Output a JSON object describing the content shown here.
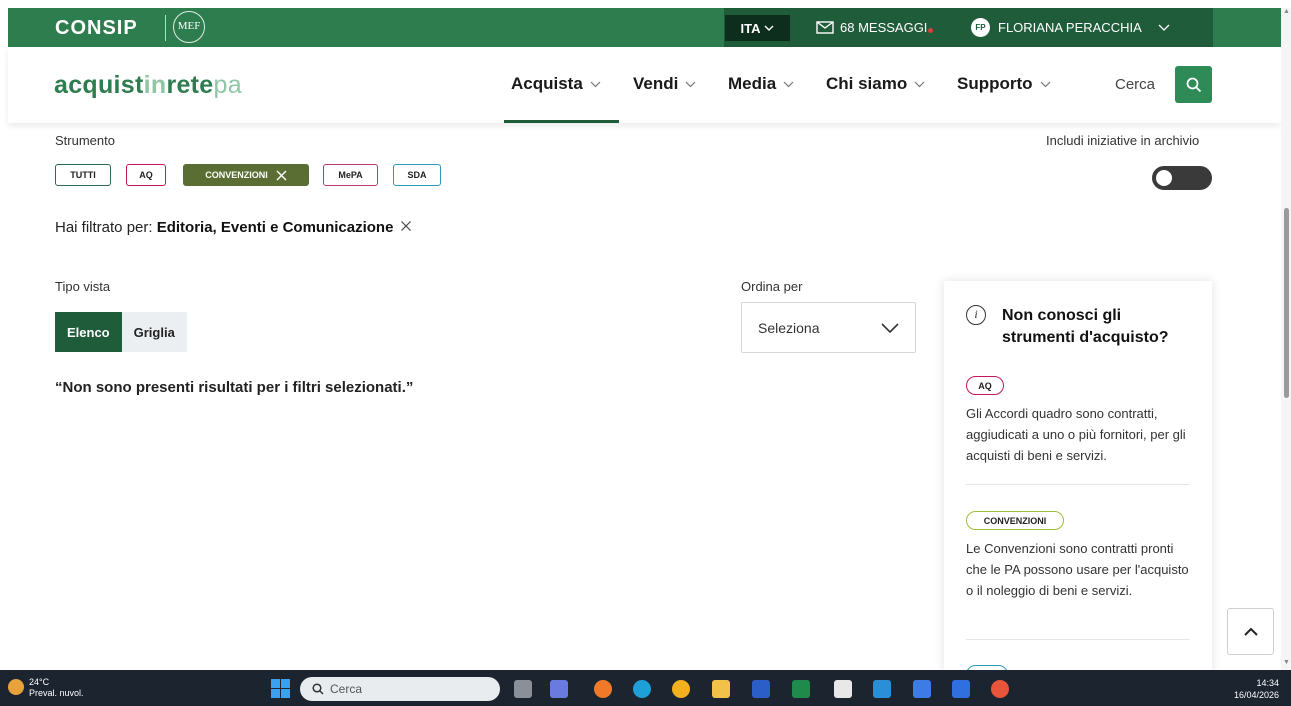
{
  "topbar": {
    "brand": "CONSIP",
    "mef": "MEF",
    "language": "ITA",
    "messages": "68 MESSAGGI",
    "avatar_initials": "FP",
    "user_name": "FLORIANA PERACCHIA",
    "colors": {
      "green": "#2e7d4f",
      "dark_green": "#1f5c3a"
    }
  },
  "header": {
    "logo_part1": "acquist",
    "logo_part2": "in",
    "logo_part3": "rete",
    "logo_part4": "pa",
    "nav": [
      "Acquista",
      "Vendi",
      "Media",
      "Chi siamo",
      "Supporto"
    ],
    "active_nav": "Acquista",
    "search_label": "Cerca"
  },
  "filters": {
    "strumento_label": "Strumento",
    "chips": [
      "TUTTI",
      "AQ",
      "CONVENZIONI",
      "MePA",
      "SDA"
    ],
    "active_chip": "CONVENZIONI",
    "archive_label": "Includi iniziative in archivio",
    "archive_enabled": false,
    "filtered_prefix": "Hai filtrato per:",
    "filtered_value": "Editoria, Eventi e Comunicazione"
  },
  "view": {
    "label": "Tipo vista",
    "options": [
      "Elenco",
      "Griglia"
    ],
    "selected": "Elenco"
  },
  "sort": {
    "label": "Ordina per",
    "value": "Seleziona"
  },
  "results": {
    "empty_message": "“Non sono presenti risultati per i filtri selezionati.”"
  },
  "info_card": {
    "title": "Non conosci gli strumenti d'acquisto?",
    "items": [
      {
        "tag": "AQ",
        "text": "Gli Accordi quadro sono contratti, aggiudicati a uno o più fornitori, per gli acquisti di beni e servizi."
      },
      {
        "tag": "CONVENZIONI",
        "text": "Le Convenzioni sono contratti pronti che le PA possono usare per l'acquisto o il noleggio di beni e servizi."
      }
    ]
  },
  "taskbar": {
    "temperature": "24°C",
    "weather": "Preval. nuvol.",
    "search_placeholder": "Cerca",
    "time": "14:34",
    "date": "16/04/2026"
  }
}
